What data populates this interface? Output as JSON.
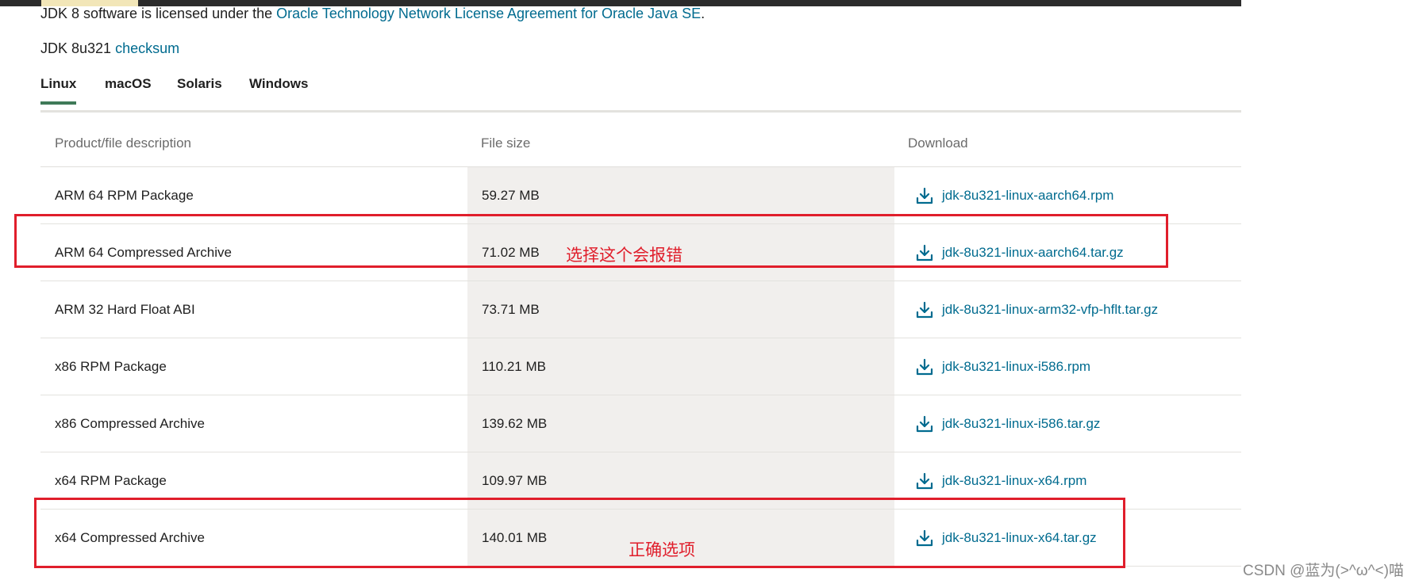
{
  "license": {
    "prefix": "JDK 8 software is licensed under the ",
    "link": "Oracle Technology Network License Agreement for Oracle Java SE",
    "suffix": "."
  },
  "checksum": {
    "prefix": "JDK 8u321 ",
    "link": "checksum"
  },
  "tabs": [
    {
      "label": "Linux",
      "active": true
    },
    {
      "label": "macOS",
      "active": false
    },
    {
      "label": "Solaris",
      "active": false
    },
    {
      "label": "Windows",
      "active": false
    }
  ],
  "table": {
    "headers": [
      "Product/file description",
      "File size",
      "Download"
    ],
    "rows": [
      {
        "description": "ARM 64 RPM Package",
        "size": "59.27 MB",
        "file": "jdk-8u321-linux-aarch64.rpm"
      },
      {
        "description": "ARM 64 Compressed Archive",
        "size": "71.02 MB",
        "file": "jdk-8u321-linux-aarch64.tar.gz"
      },
      {
        "description": "ARM 32 Hard Float ABI",
        "size": "73.71 MB",
        "file": "jdk-8u321-linux-arm32-vfp-hflt.tar.gz"
      },
      {
        "description": "x86 RPM Package",
        "size": "110.21 MB",
        "file": "jdk-8u321-linux-i586.rpm"
      },
      {
        "description": "x86 Compressed Archive",
        "size": "139.62 MB",
        "file": "jdk-8u321-linux-i586.tar.gz"
      },
      {
        "description": "x64 RPM Package",
        "size": "109.97 MB",
        "file": "jdk-8u321-linux-x64.rpm"
      },
      {
        "description": "x64 Compressed Archive",
        "size": "140.01 MB",
        "file": "jdk-8u321-linux-x64.tar.gz"
      }
    ]
  },
  "annotations": {
    "wrong": "选择这个会报错",
    "correct": "正确选项"
  },
  "watermark": "CSDN @蓝为(>^ω^<)喵",
  "colors": {
    "link": "#006b8f",
    "annotation": "#e01e2b",
    "active_tab_underline": "#3f7a58",
    "file_size_column_bg": "#f1efed"
  }
}
